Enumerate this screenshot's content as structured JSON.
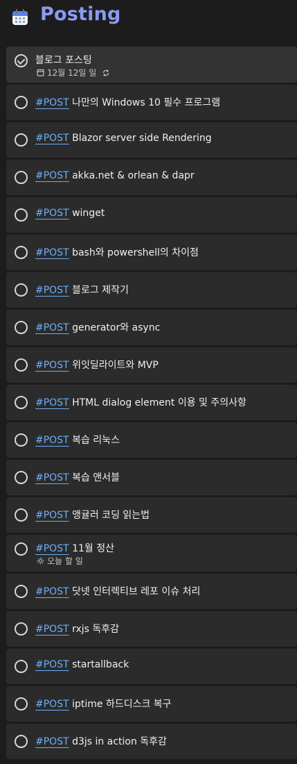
{
  "header": {
    "title": "Posting",
    "icon": "calendar-icon"
  },
  "first_task": {
    "title": "블로그 포스팅",
    "due": "12월 12일 일",
    "icons": [
      "calendar-small-icon",
      "repeat-icon"
    ]
  },
  "tag": "#POST",
  "tasks": [
    {
      "title": "나만의 Windows 10 필수 프로그램"
    },
    {
      "title": "Blazor server side Rendering"
    },
    {
      "title": "akka.net & orlean & dapr"
    },
    {
      "title": "winget"
    },
    {
      "title": "bash와 powershell의 차이점"
    },
    {
      "title": "블로그 제작기"
    },
    {
      "title": "generator와 async"
    },
    {
      "title": "위잇딜라이트와 MVP"
    },
    {
      "title": "HTML dialog element 이용 및 주의사항"
    },
    {
      "title": "복습 리눅스"
    },
    {
      "title": "복습 앤서블"
    },
    {
      "title": "앵귤러 코딩 읽는법"
    },
    {
      "title": "11월 정산",
      "sub": "오늘 할 일",
      "sub_icon": "sun-icon"
    },
    {
      "title": "닷넷 인터렉티브 레포 이슈 처리"
    },
    {
      "title": "rxjs 독후감"
    },
    {
      "title": "startallback"
    },
    {
      "title": "iptime 하드디스크 복구"
    },
    {
      "title": "d3js in action 독후감"
    }
  ],
  "colors": {
    "title": "#8b9bf2",
    "tag": "#6eaef7",
    "row": "#2b2b2b",
    "background": "#1c1c1c"
  }
}
